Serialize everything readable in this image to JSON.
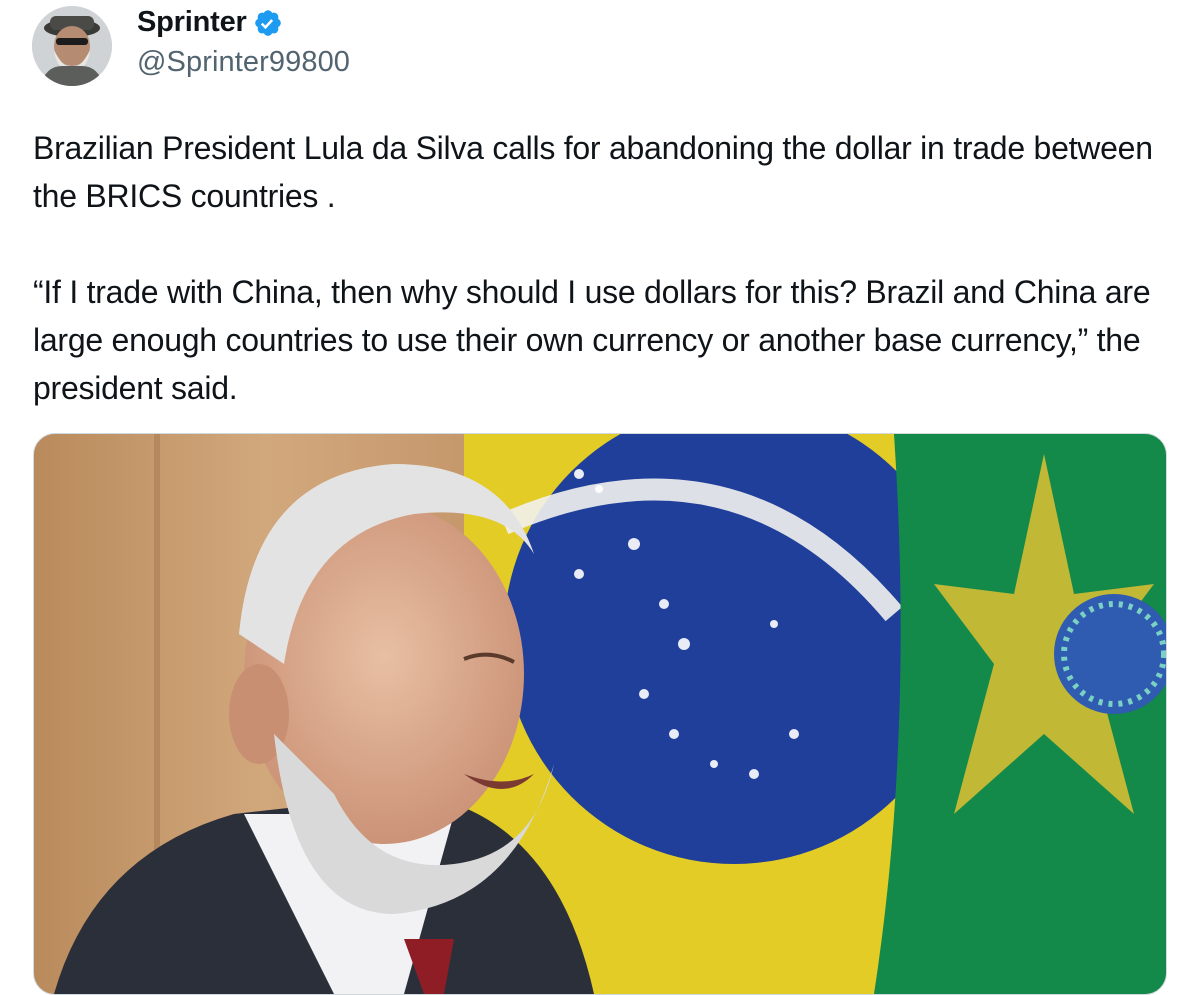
{
  "author": {
    "display_name": "Sprinter",
    "handle": "@Sprinter99800",
    "verified": true,
    "avatar_icon": "avatar-bearded-man-in-cap",
    "verified_icon": "verified-check-badge",
    "verified_color": "#1d9bf0"
  },
  "tweet": {
    "paragraphs": [
      "Brazilian President Lula da Silva calls for abandoning the dollar in trade between the BRICS countries .",
      "“If I trade with China, then why should I use dollars for this? Brazil and China are large enough countries to use their own currency or another base currency,” the president said."
    ]
  },
  "media": {
    "type": "photo",
    "icon": "photo-lula-with-brazilian-flag"
  },
  "colors": {
    "text": "#0f1419",
    "secondary_text": "#536471",
    "border": "#cfd9de"
  }
}
